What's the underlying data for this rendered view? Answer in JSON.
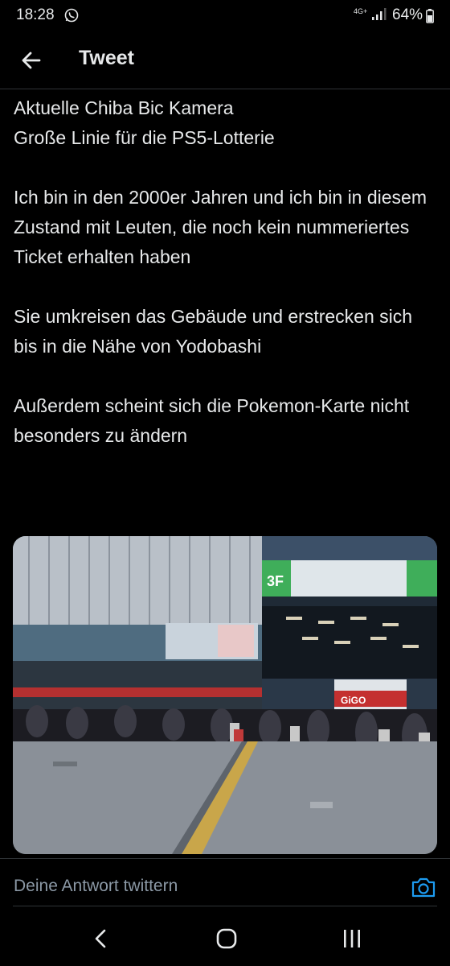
{
  "status_bar": {
    "time": "18:28",
    "network": "4G+",
    "battery": "64%",
    "icons": [
      "whatsapp-icon",
      "signal-icon",
      "battery-icon"
    ]
  },
  "header": {
    "title": "Tweet",
    "back_icon": "arrow-left-icon"
  },
  "tweet": {
    "paragraphs": [
      "Aktuelle Chiba Bic Kamera\nGroße Linie für die PS5-Lotterie",
      "Ich bin in den 2000er Jahren und ich bin in diesem Zustand mit Leuten, die noch kein nummeriertes Ticket erhalten haben",
      "Sie umkreisen das Gebäude und erstrecken sich bis in die Nähe von Yodobashi",
      "Außerdem scheint sich die Pokemon-Karte nicht besonders zu ändern"
    ],
    "photo": {
      "floor_sign": "3F",
      "store_sign": "GiGO"
    }
  },
  "reply": {
    "placeholder": "Deine Antwort twittern",
    "camera_icon": "camera-icon"
  },
  "nav_bar": {
    "icons": [
      "back-chevron-icon",
      "home-icon",
      "recents-icon"
    ]
  },
  "colors": {
    "background": "#000000",
    "text": "#e7e9ea",
    "muted": "#8b98a5",
    "accent": "#1d9bf0",
    "divider": "#2f3336"
  }
}
